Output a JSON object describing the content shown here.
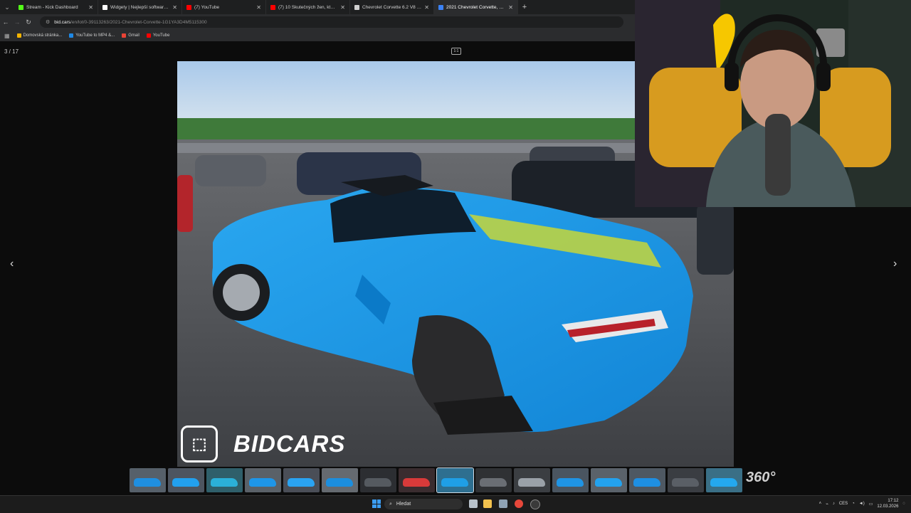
{
  "tabs": [
    {
      "title": "Stream - Kick Dashboard",
      "color": "#53fc18",
      "active": false
    },
    {
      "title": "Widgety | Nejlepší software pro",
      "color": "#ffffff",
      "active": false
    },
    {
      "title": "(7) YouTube",
      "color": "#ff0000",
      "active": false
    },
    {
      "title": "(7) 10 Skutečných žen, které js",
      "color": "#ff0000",
      "active": false
    },
    {
      "title": "Chevrolet Corvette 6.2 V8 Sting",
      "color": "#cfcfcf",
      "active": false
    },
    {
      "title": "2021 Chevrolet Corvette, Sting",
      "color": "#3b82f6",
      "active": true
    }
  ],
  "new_tab": "+",
  "address": {
    "site": "bid.cars",
    "path": "/en/lot/0-39113263/2021-Chevrolet-Corvette-1G1YA3D4M5115300"
  },
  "bookmarks": [
    {
      "label": "Domovská stránka...",
      "color": "#f4b400"
    },
    {
      "label": "YouTube to MP4 &...",
      "color": "#1e88e5"
    },
    {
      "label": "Gmail",
      "color": "#ea4335"
    },
    {
      "label": "YouTube",
      "color": "#ff0000"
    }
  ],
  "viewer": {
    "counter": "3 / 17",
    "fit_label": "1:1",
    "watermark": "BIDCARS",
    "badge_360": "360°"
  },
  "thumbnail_count": 16,
  "taskbar": {
    "search_label": "Hledat",
    "lang": "CES",
    "time": "17:12",
    "date": "12.03.2026"
  }
}
